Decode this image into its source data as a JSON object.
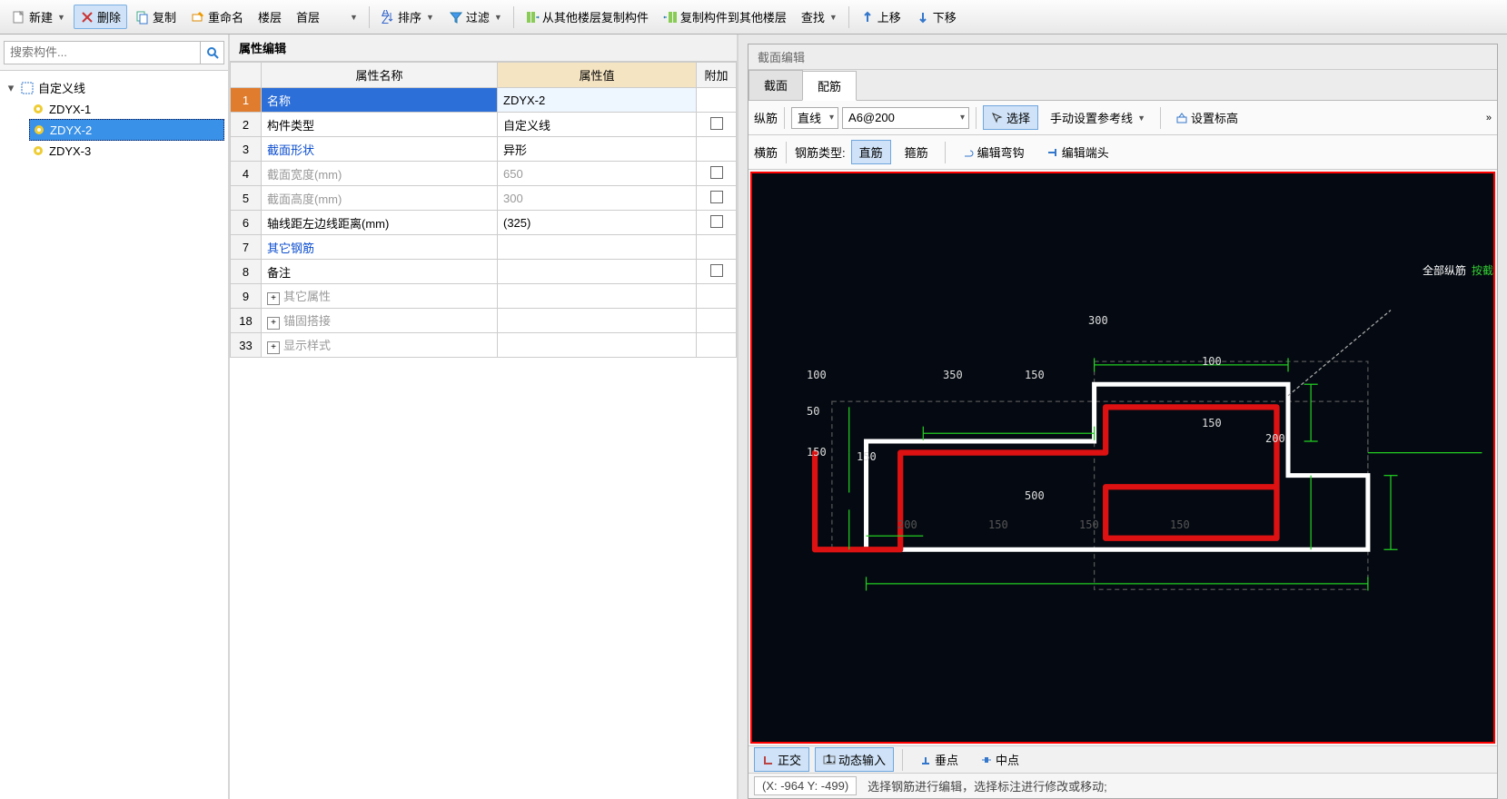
{
  "toolbar": {
    "new": "新建",
    "delete": "删除",
    "copy": "复制",
    "rename": "重命名",
    "floor": "楼层",
    "first_floor": "首层",
    "sort": "排序",
    "filter": "过滤",
    "copy_from": "从其他楼层复制构件",
    "copy_to": "复制构件到其他楼层",
    "find": "查找",
    "move_up": "上移",
    "move_down": "下移"
  },
  "search": {
    "placeholder": "搜索构件..."
  },
  "tree": {
    "root": "自定义线",
    "items": [
      "ZDYX-1",
      "ZDYX-2",
      "ZDYX-3"
    ],
    "selected": "ZDYX-2"
  },
  "prop_editor": {
    "title": "属性编辑",
    "col_name": "属性名称",
    "col_value": "属性值",
    "col_extra": "附加",
    "rows": [
      {
        "n": "1",
        "name": "名称",
        "val": "ZDYX-2",
        "chk": false,
        "sel": true
      },
      {
        "n": "2",
        "name": "构件类型",
        "val": "自定义线",
        "chk": true
      },
      {
        "n": "3",
        "name": "截面形状",
        "val": "异形",
        "blue": true
      },
      {
        "n": "4",
        "name": "截面宽度(mm)",
        "val": "650",
        "gray": true,
        "chk": true
      },
      {
        "n": "5",
        "name": "截面高度(mm)",
        "val": "300",
        "gray": true,
        "chk": true
      },
      {
        "n": "6",
        "name": "轴线距左边线距离(mm)",
        "val": "(325)",
        "chk": true
      },
      {
        "n": "7",
        "name": "其它钢筋",
        "val": "",
        "blue": true
      },
      {
        "n": "8",
        "name": "备注",
        "val": "",
        "chk": true
      },
      {
        "n": "9",
        "name": "其它属性",
        "val": "",
        "gray": true,
        "exp": true
      },
      {
        "n": "18",
        "name": "锚固搭接",
        "val": "",
        "gray": true,
        "exp": true
      },
      {
        "n": "33",
        "name": "显示样式",
        "val": "",
        "gray": true,
        "exp": true
      }
    ]
  },
  "section_editor": {
    "title": "截面编辑",
    "tab_section": "截面",
    "tab_rebar": "配筋",
    "long_rebar": "纵筋",
    "line": "直线",
    "spec": "A6@200",
    "select": "选择",
    "manual_ref": "手动设置参考线",
    "set_elev": "设置标高",
    "cross_rebar": "横筋",
    "rebar_type": "钢筋类型:",
    "straight": "直筋",
    "stirrup": "箍筋",
    "edit_hook": "编辑弯钩",
    "edit_end": "编辑端头",
    "ortho": "正交",
    "dyn_input": "动态输入",
    "perp": "垂点",
    "midpoint": "中点",
    "coord": "(X: -964 Y: -499)",
    "hint": "选择钢筋进行编辑，选择标注进行修改或移动;",
    "annot_all": "全部纵筋",
    "annot_by": "按截面",
    "dims": {
      "d300": "300",
      "d100": "100",
      "d350": "350",
      "d150": "150",
      "d50": "50",
      "d500": "500",
      "d200": "200",
      "d150b": "150",
      "d150c": "150",
      "d150d": "150",
      "d200b": "200",
      "d100b": "100"
    }
  }
}
